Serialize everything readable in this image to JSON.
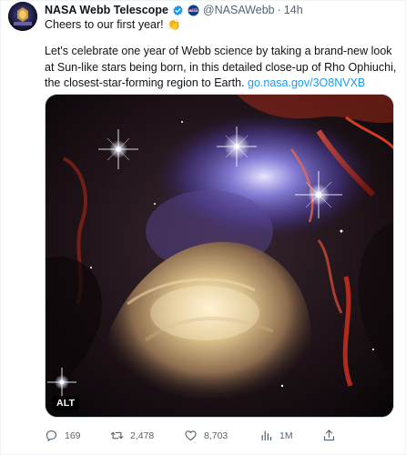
{
  "tweet": {
    "author_name": "NASA Webb Telescope",
    "handle": "@NASAWebb",
    "separator": "·",
    "time": "14h",
    "first_line": "Cheers to our first year!",
    "first_line_emoji": "👏",
    "body": "Let's celebrate one year of Webb science by taking a brand-new look at Sun-like stars being born, in this detailed close-up of Rho Ophiuchi, the closest-star-forming region to Earth. ",
    "link": "go.nasa.gov/3O8NVXB",
    "media_alt_badge": "ALT"
  },
  "actions": {
    "replies": "169",
    "retweets": "2,478",
    "likes": "8,703",
    "views": "1M"
  },
  "colors": {
    "text": "#0f1419",
    "secondary": "#536471",
    "link": "#1d9bf0",
    "verified": "#1d9bf0"
  },
  "icons": [
    "reply-icon",
    "retweet-icon",
    "like-icon",
    "views-icon",
    "share-icon",
    "verified-icon",
    "nasa-logo-icon"
  ]
}
